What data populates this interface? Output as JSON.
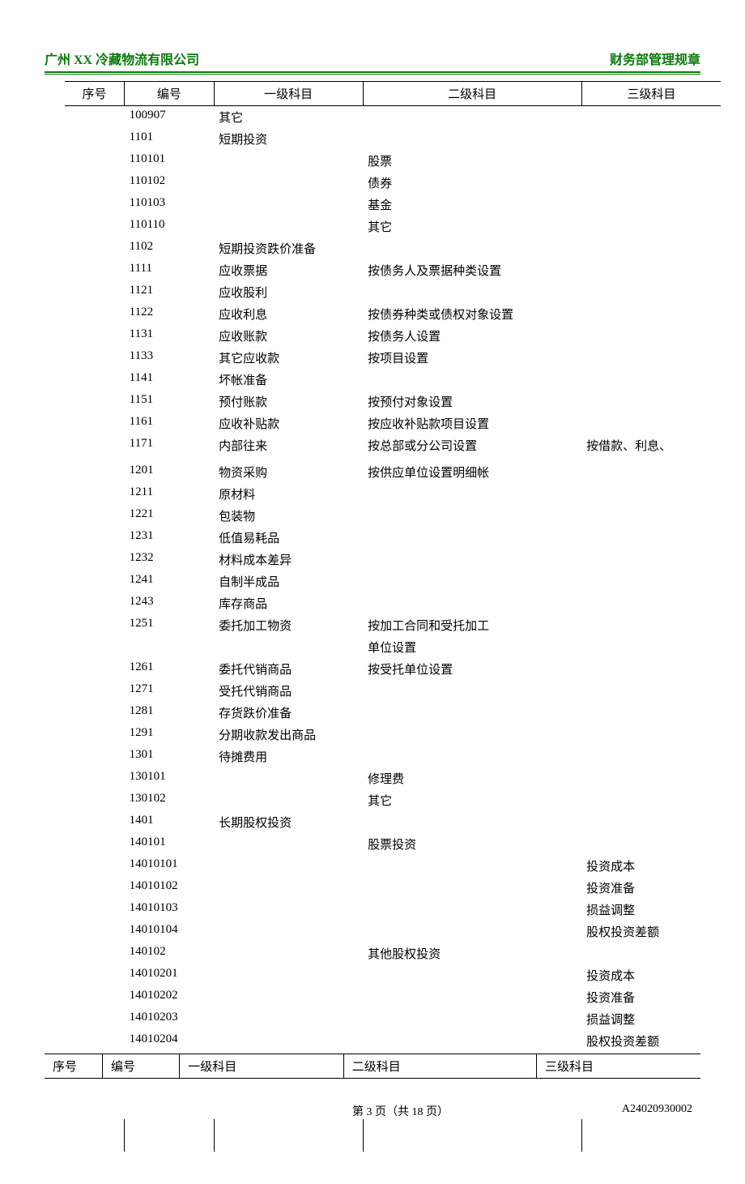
{
  "header": {
    "company": "广州 XX 冷藏物流有限公司",
    "docTitle": "财务部管理规章"
  },
  "columns": {
    "seq": "序号",
    "code": "编号",
    "level1": "一级科目",
    "level2": "二级科目",
    "level3": "三级科目"
  },
  "rows": [
    {
      "seq": "",
      "code": "100907",
      "l1": "其它",
      "l2": "",
      "l3": ""
    },
    {
      "seq": "",
      "code": "1101",
      "l1": "短期投资",
      "l2": "",
      "l3": ""
    },
    {
      "seq": "",
      "code": "110101",
      "l1": "",
      "l2": "股票",
      "l3": ""
    },
    {
      "seq": "",
      "code": "110102",
      "l1": "",
      "l2": "债券",
      "l3": ""
    },
    {
      "seq": "",
      "code": "110103",
      "l1": "",
      "l2": "基金",
      "l3": ""
    },
    {
      "seq": "",
      "code": "110110",
      "l1": "",
      "l2": "其它",
      "l3": ""
    },
    {
      "seq": "",
      "code": "1102",
      "l1": "短期投资跌价准备",
      "l2": "",
      "l3": ""
    },
    {
      "seq": "",
      "code": "1111",
      "l1": "应收票据",
      "l2": "按债务人及票据种类设置",
      "l3": ""
    },
    {
      "seq": "",
      "code": "1121",
      "l1": "应收股利",
      "l2": "",
      "l3": ""
    },
    {
      "seq": "",
      "code": "1122",
      "l1": "应收利息",
      "l2": "按债券种类或债权对象设置",
      "l3": ""
    },
    {
      "seq": "",
      "code": "1131",
      "l1": "应收账款",
      "l2": "按债务人设置",
      "l3": ""
    },
    {
      "seq": "",
      "code": "1133",
      "l1": "其它应收款",
      "l2": "按项目设置",
      "l3": ""
    },
    {
      "seq": "",
      "code": "1141",
      "l1": "坏帐准备",
      "l2": "",
      "l3": ""
    },
    {
      "seq": "",
      "code": "1151",
      "l1": "预付账款",
      "l2": "按预付对象设置",
      "l3": ""
    },
    {
      "seq": "",
      "code": "1161",
      "l1": "应收补贴款",
      "l2": "按应收补贴款项目设置",
      "l3": ""
    },
    {
      "seq": "",
      "code": "1171",
      "l1": "内部往来",
      "l2": "按总部或分公司设置",
      "l3": "按借款、利息、"
    },
    {
      "seq": "",
      "code": "",
      "l1": "",
      "l2": "",
      "l3": ""
    },
    {
      "seq": "",
      "code": "1201",
      "l1": "物资采购",
      "l2": "按供应单位设置明细帐",
      "l3": ""
    },
    {
      "seq": "",
      "code": "1211",
      "l1": "原材料",
      "l2": "",
      "l3": ""
    },
    {
      "seq": "",
      "code": "1221",
      "l1": "包装物",
      "l2": "",
      "l3": ""
    },
    {
      "seq": "",
      "code": "1231",
      "l1": "低值易耗品",
      "l2": "",
      "l3": ""
    },
    {
      "seq": "",
      "code": "1232",
      "l1": "材料成本差异",
      "l2": "",
      "l3": ""
    },
    {
      "seq": "",
      "code": "1241",
      "l1": "自制半成品",
      "l2": "",
      "l3": ""
    },
    {
      "seq": "",
      "code": "1243",
      "l1": "库存商品",
      "l2": "",
      "l3": ""
    },
    {
      "seq": "",
      "code": "1251",
      "l1": "委托加工物资",
      "l2": "按加工合同和受托加工",
      "l3": ""
    },
    {
      "seq": "",
      "code": "",
      "l1": "",
      "l2": "单位设置",
      "l3": ""
    },
    {
      "seq": "",
      "code": "1261",
      "l1": "委托代销商品",
      "l2": "按受托单位设置",
      "l3": ""
    },
    {
      "seq": "",
      "code": "1271",
      "l1": "受托代销商品",
      "l2": "",
      "l3": ""
    },
    {
      "seq": "",
      "code": "1281",
      "l1": "存货跌价准备",
      "l2": "",
      "l3": ""
    },
    {
      "seq": "",
      "code": "1291",
      "l1": "分期收款发出商品",
      "l2": "",
      "l3": ""
    },
    {
      "seq": "",
      "code": "1301",
      "l1": "待摊费用",
      "l2": "",
      "l3": ""
    },
    {
      "seq": "",
      "code": "130101",
      "l1": "",
      "l2": "修理费",
      "l3": ""
    },
    {
      "seq": "",
      "code": "130102",
      "l1": "",
      "l2": "其它",
      "l3": ""
    },
    {
      "seq": "",
      "code": "1401",
      "l1": "长期股权投资",
      "l2": "",
      "l3": ""
    },
    {
      "seq": "",
      "code": "140101",
      "l1": "",
      "l2": "股票投资",
      "l3": ""
    },
    {
      "seq": "",
      "code": "14010101",
      "l1": "",
      "l2": "",
      "l3": "投资成本"
    },
    {
      "seq": "",
      "code": "14010102",
      "l1": "",
      "l2": "",
      "l3": "投资准备"
    },
    {
      "seq": "",
      "code": "14010103",
      "l1": "",
      "l2": "",
      "l3": "损益调整"
    },
    {
      "seq": "",
      "code": "14010104",
      "l1": "",
      "l2": "",
      "l3": "股权投资差额"
    },
    {
      "seq": "",
      "code": "140102",
      "l1": "",
      "l2": "其他股权投资",
      "l3": ""
    },
    {
      "seq": "",
      "code": "14010201",
      "l1": "",
      "l2": "",
      "l3": "投资成本"
    },
    {
      "seq": "",
      "code": "14010202",
      "l1": "",
      "l2": "",
      "l3": "投资准备"
    },
    {
      "seq": "",
      "code": "14010203",
      "l1": "",
      "l2": "",
      "l3": "损益调整"
    },
    {
      "seq": "",
      "code": "14010204",
      "l1": "",
      "l2": "",
      "l3": "股权投资差额"
    }
  ],
  "footer": {
    "pageText": "第 3 页（共 18 页）",
    "docCode": "A24020930002"
  }
}
